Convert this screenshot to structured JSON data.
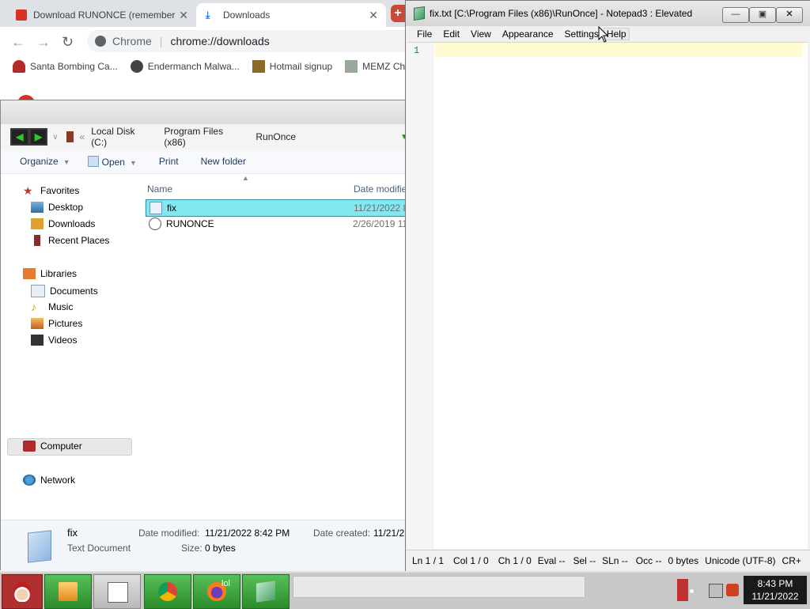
{
  "chrome": {
    "tabs": [
      {
        "title": "Download RUNONCE (remember"
      },
      {
        "title": "Downloads"
      }
    ],
    "omnibox": {
      "site_label": "Chrome",
      "separator": "|",
      "url": "chrome://downloads"
    },
    "bookmarks": [
      "Santa Bombing Ca...",
      "Endermanch Malwa...",
      "Hotmail signup",
      "MEMZ Ch"
    ]
  },
  "explorer": {
    "breadcrumbs": [
      "Local Disk (C:)",
      "Program Files (x86)",
      "RunOnce"
    ],
    "commands": [
      "Organize",
      "Open",
      "Print",
      "New folder"
    ],
    "nav": {
      "favorites": {
        "label": "Favorites",
        "items": [
          "Desktop",
          "Downloads",
          "Recent Places"
        ]
      },
      "libraries": {
        "label": "Libraries",
        "items": [
          "Documents",
          "Music",
          "Pictures",
          "Videos"
        ]
      },
      "computer": "Computer",
      "network": "Network"
    },
    "columns": {
      "name": "Name",
      "date": "Date modifie"
    },
    "files": [
      {
        "name": "fix",
        "date": "11/21/2022 8"
      },
      {
        "name": "RUNONCE",
        "date": "2/26/2019 11"
      }
    ],
    "details": {
      "name": "fix",
      "type": "Text Document",
      "date_modified_label": "Date modified:",
      "date_modified": "11/21/2022 8:42 PM",
      "date_created_label": "Date created:",
      "date_created": "11/21/2",
      "size_label": "Size:",
      "size": "0 bytes"
    }
  },
  "notepad": {
    "title": "fix.txt [C:\\Program Files (x86)\\RunOnce] - Notepad3 : Elevated",
    "menu": [
      "File",
      "Edit",
      "View",
      "Appearance",
      "Settings",
      "Help"
    ],
    "line_number": "1",
    "status": [
      "Ln 1 / 1",
      "Col 1 / 0",
      "Ch 1 / 0",
      "Eval --",
      "Sel --",
      "SLn --",
      "Occ --",
      "0 bytes",
      "Unicode (UTF-8)",
      "CR+"
    ]
  },
  "taskbar": {
    "lol_label": "lol",
    "clock_time": "8:43 PM",
    "clock_date": "11/21/2022"
  },
  "colors": {
    "selection": "#7fe8f0",
    "current_line": "#fffbd3",
    "taskbar_button": "#3aa53a"
  }
}
